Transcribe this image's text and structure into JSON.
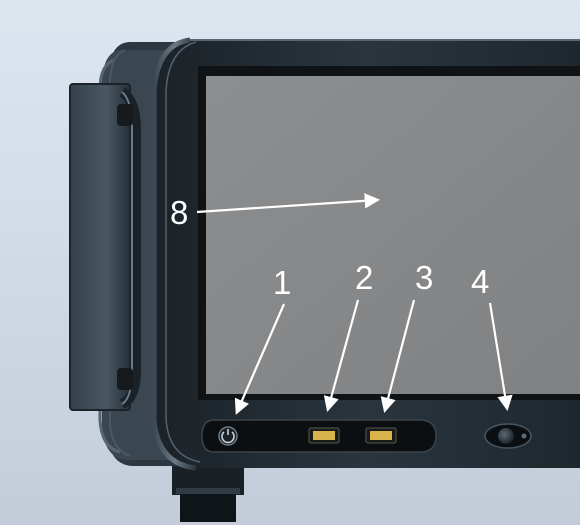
{
  "callouts": {
    "power": "1",
    "usb_port_a": "2",
    "usb_port_b": "3",
    "button_4": "4",
    "screen": "8"
  }
}
